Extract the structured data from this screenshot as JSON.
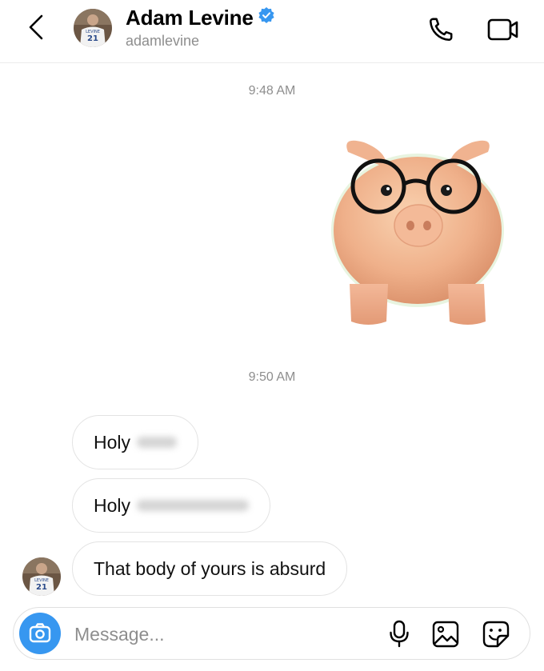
{
  "header": {
    "name": "Adam Levine",
    "username": "adamlevine",
    "avatar_jersey_number": "21",
    "avatar_jersey_text": "LEVINE",
    "verified": true
  },
  "messages": {
    "timestamp_1": "9:48 AM",
    "timestamp_2": "9:50 AM",
    "sticker": "piggy-bank-with-glasses-sticker",
    "bubble_1": "Holy",
    "bubble_2": "Holy",
    "bubble_3": "That body of yours is absurd"
  },
  "composer": {
    "placeholder": "Message..."
  },
  "colors": {
    "accent": "#3797f0",
    "verified_badge": "#3797f0",
    "muted_text": "#8e8e8e"
  },
  "icons": [
    "back-arrow-icon",
    "verified-badge-icon",
    "phone-icon",
    "video-camera-icon",
    "camera-icon",
    "microphone-icon",
    "image-icon",
    "sticker-icon"
  ]
}
